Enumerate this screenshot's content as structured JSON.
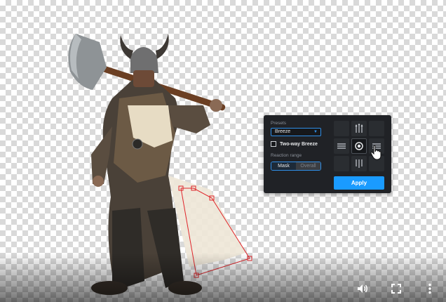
{
  "panel": {
    "presets_label": "Presets",
    "preset_value": "Breeze",
    "two_way_label": "Two-way Breeze",
    "two_way_checked": false,
    "reaction_label": "Reaction range",
    "range_options": [
      "Mask",
      "Overall"
    ],
    "range_selected": "Mask",
    "apply_label": "Apply"
  },
  "direction_grid": {
    "icons": [
      "wind-up-icon",
      "wind-left-icon",
      "center-dot-icon",
      "wind-right-icon",
      "wind-down-icon"
    ],
    "selected": "center"
  },
  "player": {
    "icons": [
      "volume-icon",
      "fullscreen-icon",
      "more-icon"
    ]
  },
  "colors": {
    "accent": "#1a9bff",
    "panel_bg": "#202226",
    "mask_outline": "#e0262b"
  }
}
